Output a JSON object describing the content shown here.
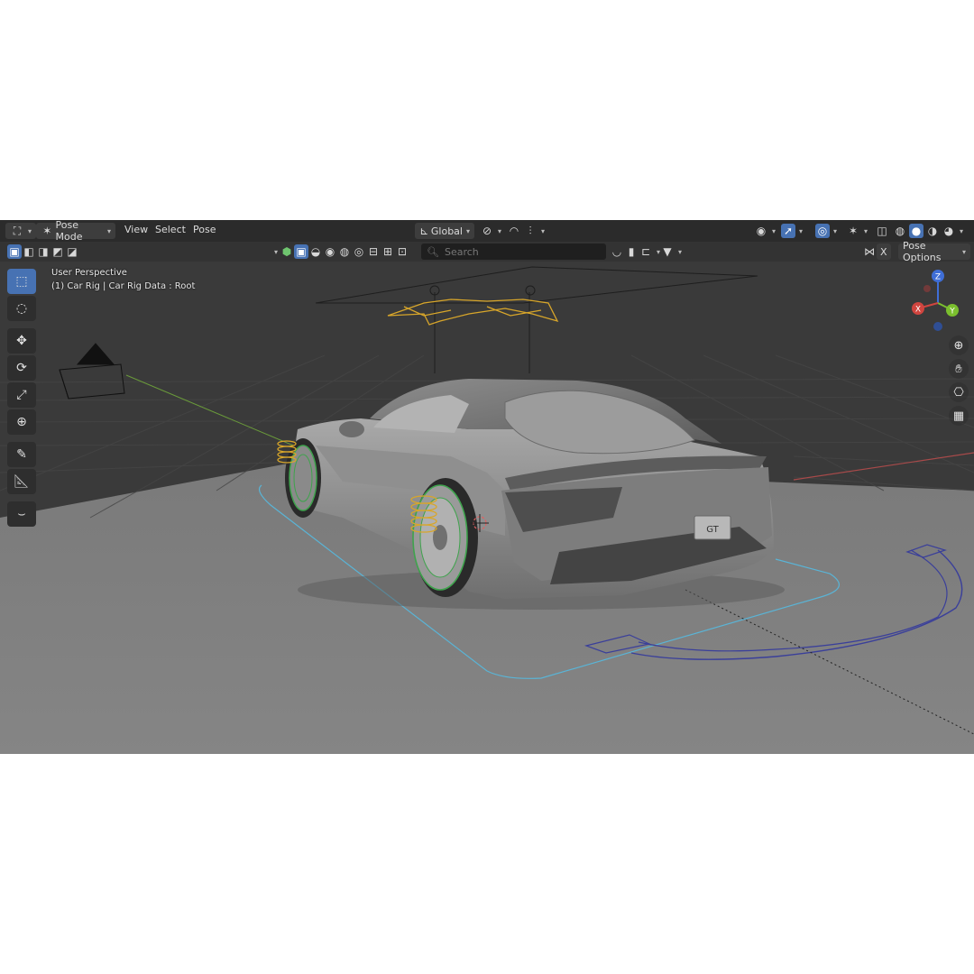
{
  "header": {
    "mode_label": "Pose Mode",
    "menus": [
      "View",
      "Select",
      "Pose"
    ],
    "transform_orientation": "Global"
  },
  "tool_header": {
    "search_placeholder": "Search",
    "pose_options_label": "Pose Options",
    "x_label": "X"
  },
  "viewport": {
    "view_name": "User Perspective",
    "object_info": "(1) Car Rig | Car Rig Data : Root",
    "car_badge": "GT"
  },
  "gizmo": {
    "z_label": "Z",
    "y_label": "Y",
    "x_label": "X"
  },
  "left_toolbar": {
    "tools": [
      {
        "name": "select-box-icon",
        "active": true
      },
      {
        "name": "cursor-icon",
        "active": false
      },
      {
        "name": "move-icon",
        "active": false
      },
      {
        "name": "rotate-icon",
        "active": false
      },
      {
        "name": "scale-icon",
        "active": false
      },
      {
        "name": "transform-icon",
        "active": false
      },
      {
        "name": "annotate-icon",
        "active": false
      },
      {
        "name": "measure-icon",
        "active": false
      },
      {
        "name": "bone-size-icon",
        "active": false
      }
    ]
  },
  "right_nav": [
    "zoom-icon",
    "hand-pan-icon",
    "camera-view-icon",
    "grid-view-icon"
  ],
  "colors": {
    "accent": "#4772b3",
    "header_bg": "#2b2b2b",
    "viewport_bg": "#3a3a3a",
    "bone_yellow": "#d8a62a",
    "wheel_green": "#3fa34d",
    "path_cyan": "#5ab4d6",
    "path_blue": "#3a3f9a"
  }
}
